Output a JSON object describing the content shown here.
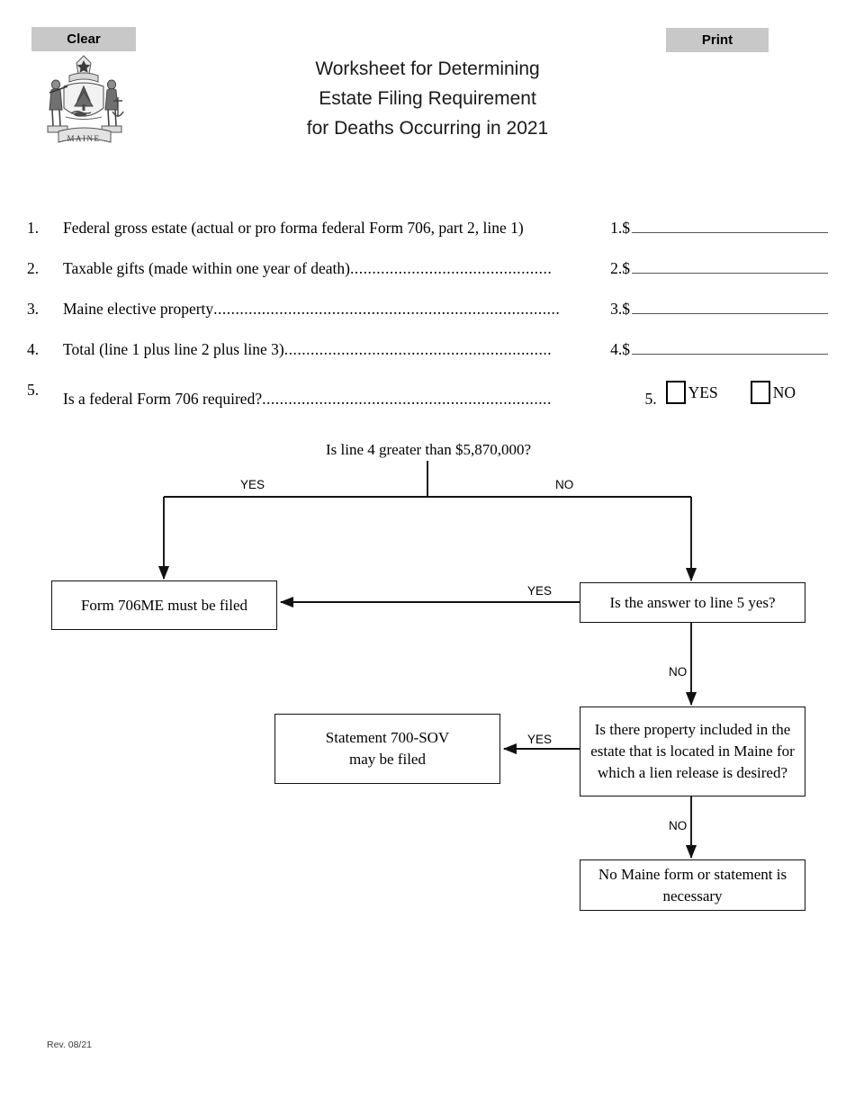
{
  "toolbar": {
    "clear_label": "Clear",
    "print_label": "Print"
  },
  "header": {
    "seal_name": "maine-state-seal",
    "title_line1": "Worksheet for Determining",
    "title_line2": "Estate Filing Requirement",
    "title_line3": "for Deaths Occurring in 2021"
  },
  "worksheet": {
    "lines": [
      {
        "num": "1.",
        "text": "Federal gross estate (actual or pro forma federal Form 706, part 2, line 1)",
        "leader": "",
        "tail": "1.",
        "dollar": "$",
        "value": ""
      },
      {
        "num": "2.",
        "text": "Taxable gifts (made within one year of death)",
        "leader": "..............................................",
        "tail": "2.",
        "dollar": "$",
        "value": ""
      },
      {
        "num": "3.",
        "text": "Maine elective property ",
        "leader": "...............................................................................",
        "tail": "3.",
        "dollar": "$",
        "value": ""
      },
      {
        "num": "4.",
        "text": "Total (line 1 plus line 2 plus line 3)",
        "leader": ".............................................................",
        "tail": "4.",
        "dollar": "$",
        "value": ""
      }
    ],
    "line5": {
      "num": "5.",
      "text": "Is a federal Form 706 required?  ",
      "leader": "..................................................................",
      "tail": "5.",
      "yes_label": "YES",
      "no_label": "NO",
      "yes_checked": false,
      "no_checked": false
    }
  },
  "flowchart": {
    "root_question": "Is line 4 greater than $5,870,000?",
    "branch_yes": "YES",
    "branch_no": "NO",
    "node_706me": "Form 706ME must be filed",
    "node_line5": "Is the answer to line 5 yes?",
    "edge_line5_yes": "YES",
    "edge_line5_no": "NO",
    "node_lien": "Is there property included in the estate that is located in Maine for which a lien release is desired?",
    "edge_lien_yes": "YES",
    "edge_lien_no": "NO",
    "node_700sov_l1": "Statement 700-SOV",
    "node_700sov_l2": "may be filed",
    "node_none_l1": "No Maine form or statement is",
    "node_none_l2": "necessary"
  },
  "footer": {
    "revision": "Rev. 08/21"
  },
  "colors": {
    "button_bg": "#c8c8c8",
    "text": "#000000",
    "rule": "#555555",
    "box_border": "#111111"
  }
}
